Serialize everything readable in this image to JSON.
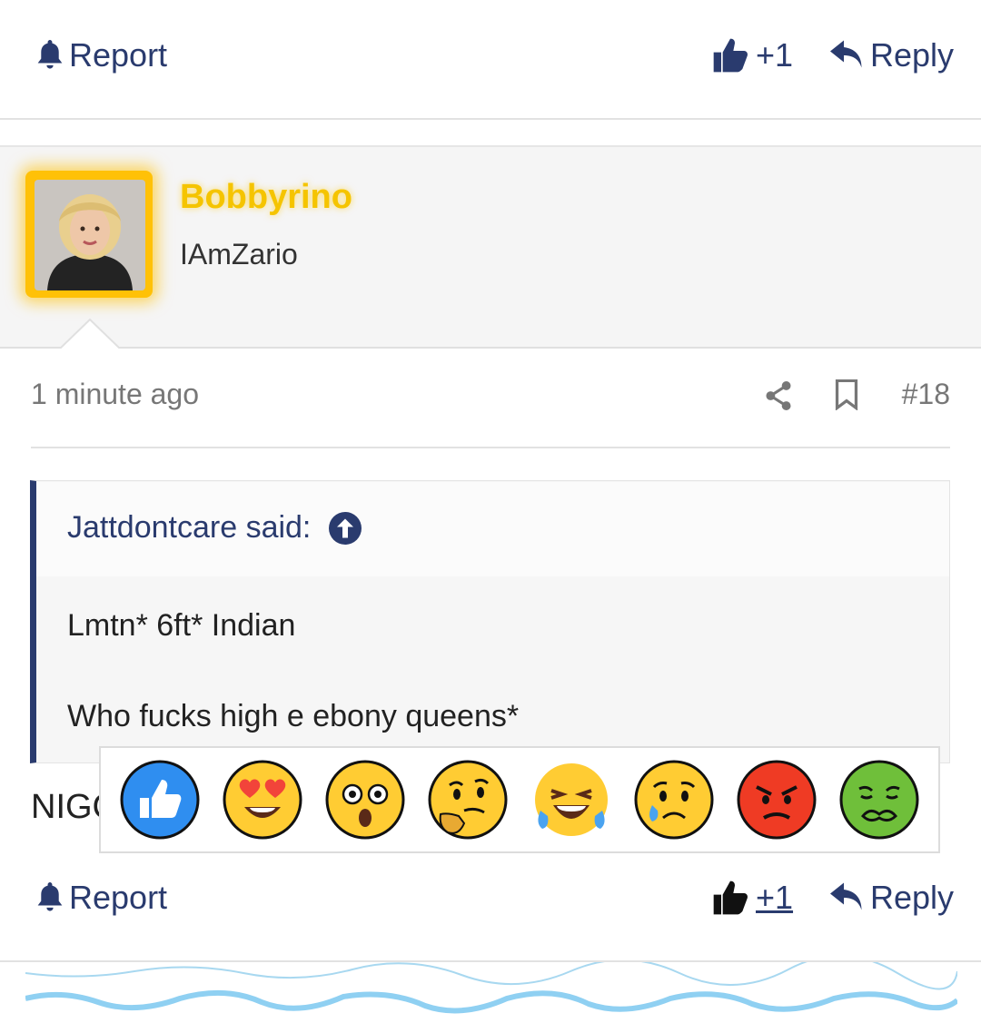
{
  "top_actions": {
    "report_label": "Report",
    "like_count": "+1",
    "reply_label": "Reply"
  },
  "author": {
    "username": "Bobbyrino",
    "user_title": "IAmZario"
  },
  "post_meta": {
    "time": "1 minute ago",
    "post_number": "#18"
  },
  "quote": {
    "author_said": "Jattdontcare said:",
    "lines": [
      "Lmtn* 6ft* Indian",
      "Who fucks high e ebony queens*"
    ]
  },
  "post_body": "NIGC",
  "reactions": [
    "like-reaction",
    "love-reaction",
    "wow-reaction",
    "thinking-reaction",
    "haha-reaction",
    "sad-reaction",
    "angry-reaction",
    "sick-reaction"
  ],
  "bottom_actions": {
    "report_label": "Report",
    "like_count": "+1",
    "reply_label": "Reply"
  },
  "colors": {
    "accent": "#2a3b6e",
    "username": "#f5c400",
    "quote_border": "#2a3b6e"
  }
}
